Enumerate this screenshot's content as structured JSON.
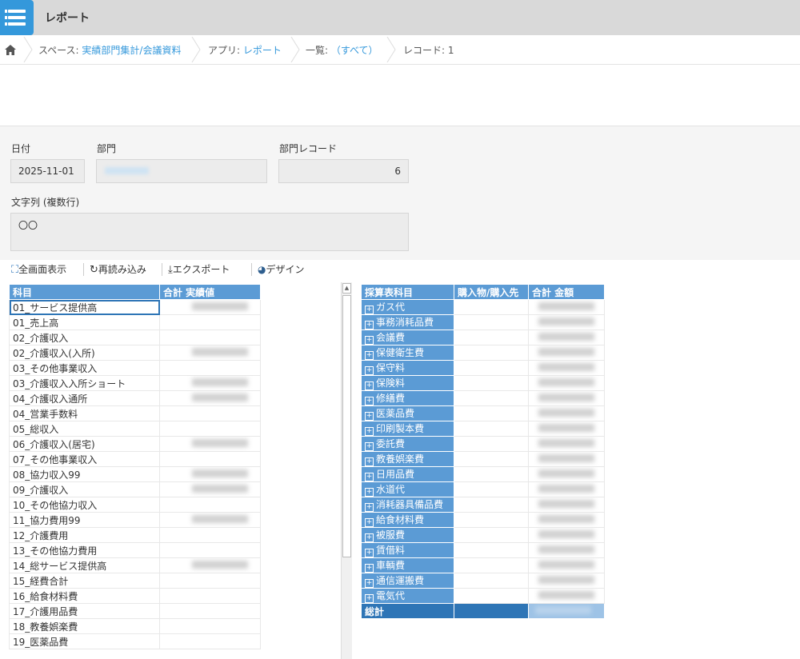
{
  "app": {
    "title": "レポート"
  },
  "breadcrumb": [
    {
      "prefix": "スペース: ",
      "value": "実績部門集計/会議資料"
    },
    {
      "prefix": "アプリ: ",
      "value": "レポート"
    },
    {
      "prefix": "一覧: ",
      "value": "（すべて）"
    },
    {
      "prefix": "レコード: ",
      "value": "1"
    }
  ],
  "form": {
    "date_label": "日付",
    "date_value": "2025-11-01",
    "dept_label": "部門",
    "dept_record_label": "部門レコード",
    "dept_record_value": "6",
    "text_label": "文字列 (複数行)",
    "text_value": "〇〇"
  },
  "toolbar": {
    "fullscreen": "全画面表示",
    "reload": "再読み込み",
    "export": "エクスポート",
    "design": "デザイン"
  },
  "left_table": {
    "headers": [
      "科目",
      "合計 実績値"
    ],
    "rows": [
      "01_サービス提供高",
      "01_売上高",
      "02_介護収入",
      "02_介護収入(入所)",
      "03_その他事業収入",
      "03_介護収入入所ショート",
      "04_介護収入通所",
      "04_営業手数料",
      "05_総収入",
      "06_介護収入(居宅)",
      "07_その他事業収入",
      "08_協力収入99",
      "09_介護収入",
      "10_その他協力収入",
      "11_協力費用99",
      "12_介護費用",
      "13_その他協力費用",
      "14_総サービス提供高",
      "15_経費合計",
      "16_給食材料費",
      "17_介護用品費",
      "18_教養娯楽費",
      "19_医薬品費"
    ]
  },
  "right_table": {
    "headers": [
      "採算表科目",
      "購入物/購入先",
      "合計 金額"
    ],
    "rows": [
      "ガス代",
      "事務消耗品費",
      "会議費",
      "保健衛生費",
      "保守料",
      "保険料",
      "修繕費",
      "医薬品費",
      "印刷製本費",
      "委託費",
      "教養娯楽費",
      "日用品費",
      "水道代",
      "消耗器具備品費",
      "給食材料費",
      "被服費",
      "賃借料",
      "車輌費",
      "通信運搬費",
      "電気代"
    ],
    "total_label": "総計"
  },
  "colors": {
    "accent": "#3498db",
    "header_blue": "#5b9bd5",
    "total_blue": "#2e75b6"
  }
}
